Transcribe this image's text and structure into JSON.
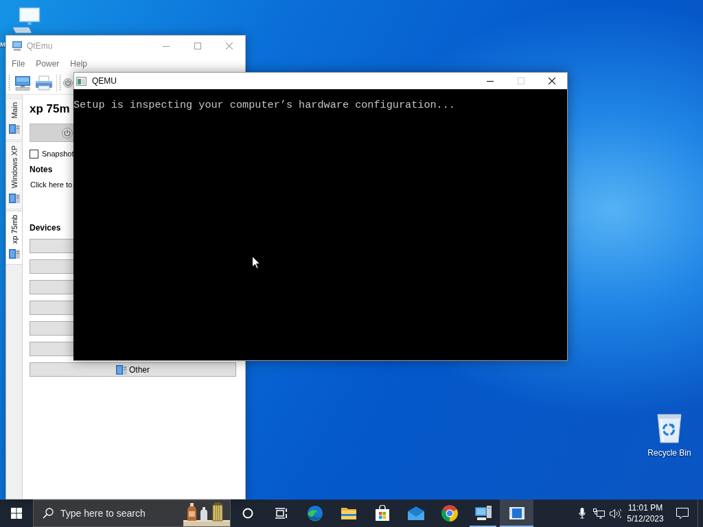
{
  "desktop_icons": [
    {
      "kind": "computer",
      "label": "M"
    },
    {
      "kind": "recycle-bin",
      "label": "Recycle Bin"
    }
  ],
  "qtemu_window": {
    "title": "QtEmu",
    "active": false,
    "menu": [
      "File",
      "Power",
      "Help"
    ],
    "side_tabs": [
      {
        "label": "Main",
        "selected": false
      },
      {
        "label": "Windows XP",
        "selected": false
      },
      {
        "label": "xp 75mb",
        "selected": true
      }
    ],
    "machine_name": "xp 75m",
    "snapshot": {
      "label": "Snapshot",
      "checked": false
    },
    "notes": {
      "heading": "Notes",
      "text": "Click here to"
    },
    "devices": {
      "heading": "Devices",
      "buttons": [
        {
          "kind": "blank"
        },
        {
          "kind": "blank"
        },
        {
          "kind": "blank"
        },
        {
          "kind": "blank"
        },
        {
          "kind": "blank"
        },
        {
          "kind": "blank"
        },
        {
          "kind": "labeled",
          "label": "Other"
        }
      ]
    }
  },
  "qemu_window": {
    "title": "QEMU",
    "active": true,
    "maximize_disabled": true,
    "console_lines": [
      "Setup is inspecting your computer’s hardware configuration..."
    ]
  },
  "taskbar": {
    "search": {
      "placeholder": "Type here to search"
    },
    "apps": [
      {
        "kind": "cortana",
        "running": false,
        "selected": false
      },
      {
        "kind": "task-view",
        "running": false,
        "selected": false
      },
      {
        "kind": "edge",
        "running": false,
        "selected": false
      },
      {
        "kind": "file-explorer",
        "running": false,
        "selected": false
      },
      {
        "kind": "store",
        "running": false,
        "selected": false
      },
      {
        "kind": "mail",
        "running": false,
        "selected": false
      },
      {
        "kind": "chrome",
        "running": false,
        "selected": false
      },
      {
        "kind": "qtemu",
        "running": true,
        "selected": false
      },
      {
        "kind": "qemu",
        "running": true,
        "selected": true
      }
    ],
    "clock": {
      "time": "11:01 PM",
      "date": "5/12/2023"
    }
  }
}
